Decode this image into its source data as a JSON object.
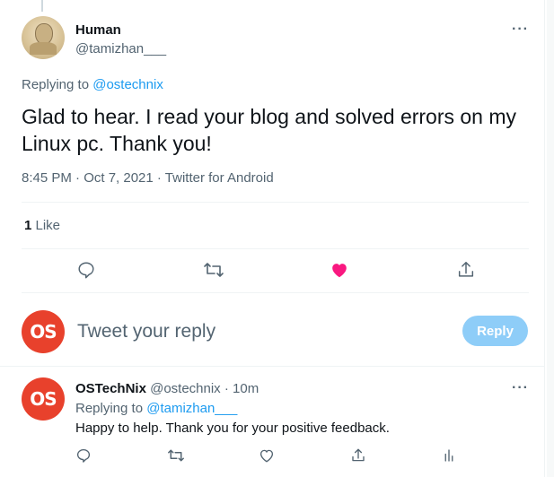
{
  "main_tweet": {
    "author_name": "Human",
    "author_handle": "@tamizhan___",
    "more_label": "···",
    "replying_label": "Replying to ",
    "replying_handle": "@ostechnix",
    "text": "Glad to hear. I read your blog and solved errors on my Linux pc. Thank you!",
    "meta": "8:45 PM · Oct 7, 2021 · Twitter for Android",
    "likes_count": "1",
    "likes_label": " Like",
    "liked": true,
    "like_color": "#f91880"
  },
  "reply_box": {
    "avatar_text": "OS",
    "placeholder": "Tweet your reply",
    "button_label": "Reply",
    "button_color": "#8ecdf8"
  },
  "reply_tweet": {
    "avatar_text": "OS",
    "author_name": "OSTechNix",
    "author_handle": " @ostechnix",
    "time": " · 10m",
    "more_label": "···",
    "replying_label": "Replying to ",
    "replying_handle": "@tamizhan___",
    "text": "Happy to help. Thank you for your positive feedback."
  },
  "icons": {
    "reply": "comment-icon",
    "retweet": "retweet-icon",
    "like": "heart-icon",
    "share": "share-icon",
    "analytics": "analytics-icon"
  },
  "colors": {
    "accent": "#1d9bf0",
    "brand_os": "#e8412c",
    "secondary_text": "#536471"
  }
}
